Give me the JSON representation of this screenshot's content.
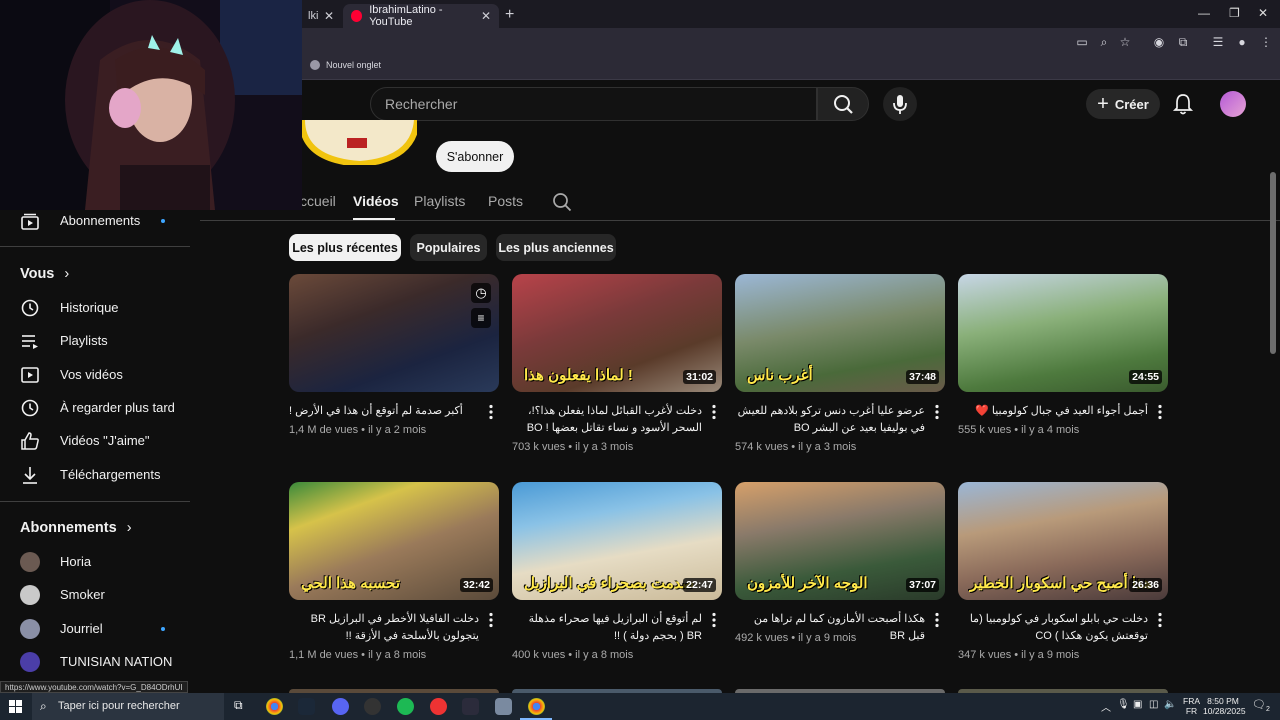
{
  "browser": {
    "tabs": [
      {
        "label": "lki",
        "active": false
      },
      {
        "label": "IbrahimLatino - YouTube",
        "active": true
      }
    ],
    "bookmark": "Nouvel onglet"
  },
  "masthead": {
    "search_placeholder": "Recherche",
    "search_value": "Rechercher",
    "create_label": "Créer"
  },
  "channel": {
    "subscribe_label": "S'abonner",
    "tabs": [
      "ccueil",
      "Vidéos",
      "Playlists",
      "Posts"
    ],
    "active_tab": "Vidéos",
    "chips": [
      "Les plus récentes",
      "Populaires",
      "Les plus anciennes"
    ]
  },
  "sidebar": {
    "top_items": [
      {
        "label": "Abonnements",
        "icon": "subscriptions-icon",
        "dot": true
      }
    ],
    "you_header": "Vous",
    "you_items": [
      {
        "label": "Historique",
        "icon": "history-icon"
      },
      {
        "label": "Playlists",
        "icon": "playlists-icon"
      },
      {
        "label": "Vos vidéos",
        "icon": "your-videos-icon"
      },
      {
        "label": "À regarder plus tard",
        "icon": "watch-later-icon"
      },
      {
        "label": "Vidéos \"J'aime\"",
        "icon": "like-icon"
      },
      {
        "label": "Téléchargements",
        "icon": "download-icon"
      }
    ],
    "subs_header": "Abonnements",
    "subs": [
      {
        "label": "Horia",
        "dot": false,
        "color": "#6b5a52"
      },
      {
        "label": "Smoker",
        "dot": false,
        "color": "#c9c9c9"
      },
      {
        "label": "Jourriel",
        "dot": true,
        "color": "#8a8fa6"
      },
      {
        "label": "TUNISIAN NATION",
        "dot": false,
        "color": "#4b3ea8"
      }
    ]
  },
  "videos": [
    {
      "title": "أكبر صدمة لم أتوقع أن هذا في الأرض !",
      "views": "1,4 M de vues",
      "age": "il y a 2 mois",
      "duration": "",
      "overlay": ""
    },
    {
      "title": "دخلت لأغرب القبائل لماذا يفعلن هذا؟!، السحر الأسود و نساء تقاتل بعضها ! BO",
      "views": "703 k vues",
      "age": "il y a 3 mois",
      "duration": "31:02",
      "overlay": "لماذا يفعلون هذا !"
    },
    {
      "title": "عرضو عليا أغرب دنس تركو بلادهم للعيش في بوليفيا بعيد عن البشر BO",
      "views": "574 k vues",
      "age": "il y a 3 mois",
      "duration": "37:48",
      "overlay": "أغرب ناس"
    },
    {
      "title": "أجمل أجواء العيد في جبال كولومبيا ❤️",
      "views": "555 k vues",
      "age": "il y a 4 mois",
      "duration": "24:55",
      "overlay": ""
    },
    {
      "title": "دخلت الفافيلا الأخطر في البرازيل BR يتجولون بالأسلحة في الأزقة !!",
      "views": "1,1 M de vues",
      "age": "il y a 8 mois",
      "duration": "32:42",
      "overlay": "تحسبه هذا الحي"
    },
    {
      "title": "لم أتوقع أن البرازيل فيها صحراء مذهلة BR ( بحجم دولة ) !!",
      "views": "400 k vues",
      "age": "il y a 8 mois",
      "duration": "22:47",
      "overlay": "صدمت بصحراء في البرازيل"
    },
    {
      "title": "هكذا أصبحت الأمازون كما لم تراها من قبل BR",
      "views": "492 k vues",
      "age": "il y a 9 mois",
      "duration": "37:07",
      "overlay": "الوجه الآخر للأمزون"
    },
    {
      "title": "دخلت حي بابلو اسكوبار في كولومبيا (ما توقعتش يكون هكذا ) CO",
      "views": "347 k vues",
      "age": "il y a 9 mois",
      "duration": "26:36",
      "overlay": "هذا أصبح حي اسكوبار الخطير"
    }
  ],
  "status_url": "https://www.youtube.com/watch?v=G_D84ODrhUI",
  "taskbar": {
    "search_placeholder": "Taper ici pour rechercher",
    "lang_1": "FRA",
    "lang_2": "FR",
    "time": "8:50 PM",
    "date": "10/28/2025",
    "notif_count": "2"
  }
}
